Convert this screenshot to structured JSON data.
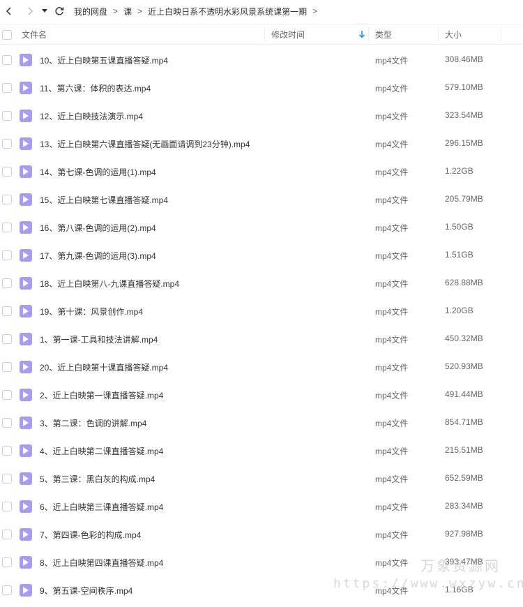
{
  "breadcrumb": [
    "我的网盘",
    "课",
    "近上白映日系不透明水彩风景系统课第一期"
  ],
  "breadcrumb_separator": ">",
  "header": {
    "name": "文件名",
    "time": "修改时间",
    "sort_icon": "sort-down-arrow-icon",
    "type": "类型",
    "size": "大小"
  },
  "files": [
    {
      "name": "10、近上白映第五课直播答疑.mp4",
      "type": "mp4文件",
      "size": "308.46MB"
    },
    {
      "name": "11、第六课：体积的表达.mp4",
      "type": "mp4文件",
      "size": "579.10MB"
    },
    {
      "name": "12、近上白映技法演示.mp4",
      "type": "mp4文件",
      "size": "323.54MB"
    },
    {
      "name": "13、近上白映第六课直播答疑(无画面请调到23分钟).mp4",
      "type": "mp4文件",
      "size": "296.15MB"
    },
    {
      "name": "14、第七课-色调的运用(1).mp4",
      "type": "mp4文件",
      "size": "1.22GB"
    },
    {
      "name": "15、近上白映第七课直播答疑.mp4",
      "type": "mp4文件",
      "size": "205.79MB"
    },
    {
      "name": "16、第八课-色调的运用(2).mp4",
      "type": "mp4文件",
      "size": "1.50GB"
    },
    {
      "name": "17、第九课-色调的运用(3).mp4",
      "type": "mp4文件",
      "size": "1.51GB"
    },
    {
      "name": "18、近上白映第八-九课直播答疑.mp4",
      "type": "mp4文件",
      "size": "628.88MB"
    },
    {
      "name": "19、第十课：风景创作.mp4",
      "type": "mp4文件",
      "size": "1.20GB"
    },
    {
      "name": "1、第一课-工具和技法讲解.mp4",
      "type": "mp4文件",
      "size": "450.32MB"
    },
    {
      "name": "20、近上白映第十课直播答疑.mp4",
      "type": "mp4文件",
      "size": "520.93MB"
    },
    {
      "name": "2、近上白映第一课直播答疑.mp4",
      "type": "mp4文件",
      "size": "491.44MB"
    },
    {
      "name": "3、第二课：色调的讲解.mp4",
      "type": "mp4文件",
      "size": "854.71MB"
    },
    {
      "name": "4、近上白映第二课直播答疑.mp4",
      "type": "mp4文件",
      "size": "215.51MB"
    },
    {
      "name": "5、第三课：黑白灰的构成.mp4",
      "type": "mp4文件",
      "size": "652.59MB"
    },
    {
      "name": "6、近上白映第三课直播答疑.mp4",
      "type": "mp4文件",
      "size": "283.34MB"
    },
    {
      "name": "7、第四课-色彩的构成.mp4",
      "type": "mp4文件",
      "size": "927.98MB"
    },
    {
      "name": "8、近上白映第四课直播答疑.mp4",
      "type": "mp4文件",
      "size": "393.47MB"
    },
    {
      "name": "9、第五课-空间秩序.mp4",
      "type": "mp4文件",
      "size": "1.16GB"
    }
  ],
  "watermark": {
    "top": "万象资源网",
    "bottom": "https://www.wxzyw.cn"
  },
  "colors": {
    "file_icon": "#a89bf1",
    "sort_arrow": "#2f8ff9",
    "border": "#eceef2"
  }
}
